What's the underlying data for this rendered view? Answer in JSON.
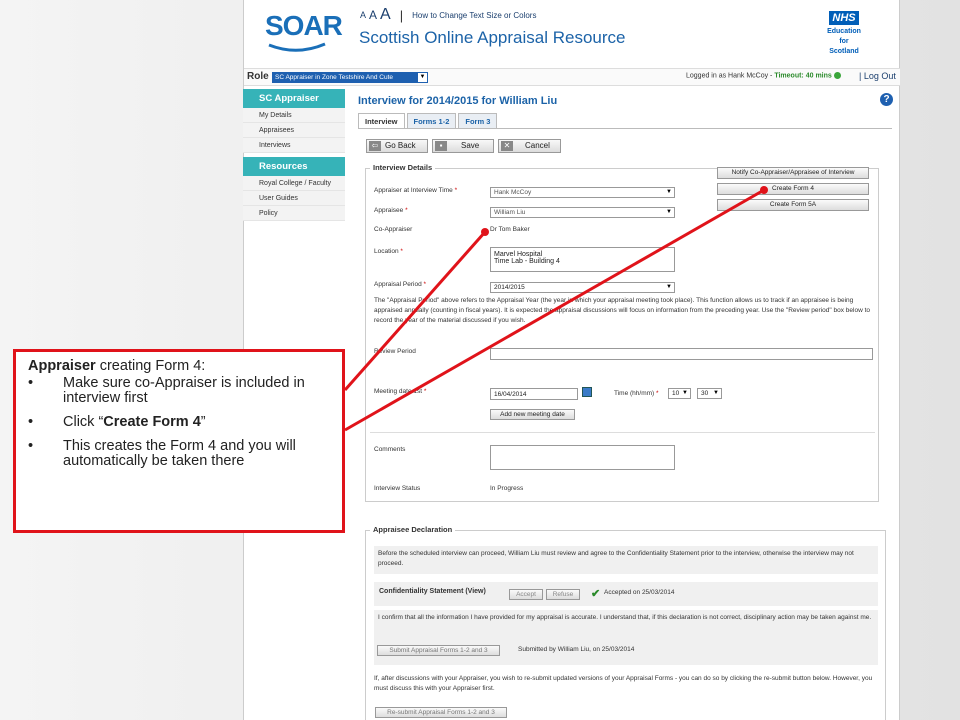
{
  "header": {
    "logo_text": "SOAR",
    "text_size_a_small": "A",
    "text_size_a_medium": "A",
    "text_size_a_large": "A",
    "text_size_separator": "|",
    "text_size_link": "How to Change Text Size or Colors",
    "site_title": "Scottish Online Appraisal Resource",
    "nhs_logo": "NHS",
    "nhs_sub_1": "Education",
    "nhs_sub_2": "for",
    "nhs_sub_3": "Scotland"
  },
  "rolebar": {
    "role_label": "Role",
    "role_value": "SC Appraiser in Zone Testshire And Cute",
    "logged_in_prefix": "Logged in as Hank McCoy - ",
    "timeout_label": "Timeout:",
    "timeout_value": "40 mins",
    "logout": "Log Out"
  },
  "sidebar": {
    "section1": "SC Appraiser",
    "items1": [
      "My Details",
      "Appraisees",
      "Interviews"
    ],
    "section2": "Resources",
    "items2": [
      "Royal College / Faculty",
      "User Guides",
      "Policy"
    ]
  },
  "main": {
    "title": "Interview for 2014/2015 for William Liu",
    "help": "?",
    "tabs": [
      "Interview",
      "Forms 1-2",
      "Form 3"
    ],
    "buttons": {
      "go_back": "Go Back",
      "save": "Save",
      "cancel": "Cancel"
    }
  },
  "details": {
    "legend": "Interview Details",
    "notify_button": "Notify Co-Appraiser/Appraisee of Interview",
    "create_form4": "Create Form 4",
    "create_form5a": "Create Form 5A",
    "appraiser_label": "Appraiser at Interview Time",
    "appraiser_value": "Hank McCoy",
    "appraisee_label": "Appraisee",
    "appraisee_value": "William Liu",
    "coappraiser_label": "Co-Appraiser",
    "coappraiser_value": "Dr Tom Baker",
    "location_label": "Location",
    "location_line1": "Marvel Hospital",
    "location_line2": "Time Lab - Building 4",
    "period_label": "Appraisal Period",
    "period_value": "2014/2015",
    "period_note": "The \"Appraisal Period\" above refers to the Appraisal Year (the year in which your appraisal meeting took place). This function allows us to track if an appraisee is being appraised annually (counting in fiscal years). It is expected the appraisal discussions will focus on information from the preceding year. Use the \"Review period\" box below to record the year of the material discussed if you wish.",
    "review_label": "Review Period",
    "meeting_label": "Meeting date 1st",
    "meeting_value": "16/04/2014",
    "time_label": "Time (hh/mm)",
    "time_hh": "10",
    "time_mm": "30",
    "add_meeting": "Add new meeting date",
    "comments_label": "Comments",
    "status_label": "Interview Status",
    "status_value": "In Progress",
    "required_mark": "*"
  },
  "declaration": {
    "legend": "Appraisee Declaration",
    "intro": "Before the scheduled interview can proceed, William Liu must review and agree to the Confidentiality Statement prior to the interview, otherwise the interview may not proceed.",
    "conf_label": "Confidentiality Statement (View)",
    "accept": "Accept",
    "refuse": "Refuse",
    "accepted_text": "Accepted on 25/03/2014",
    "confirm_text": "I confirm that all the information I have provided for my appraisal is accurate. I understand that, if this declaration is not correct, disciplinary action may be taken against me.",
    "submit_button": "Submit Appraisal Forms 1-2 and 3",
    "submitted_text": "Submitted by William Liu, on 25/03/2014",
    "resubmit_text": "If, after discussions with your Appraiser, you wish to re-submit updated versions of your Appraisal Forms - you can do so by clicking the re-submit button below. However, you must discuss this with your Appraiser first.",
    "resubmit_button": "Re-submit Appraisal Forms 1-2 and 3"
  },
  "callout": {
    "head_bold": "Appraiser",
    "head_rest": " creating Form 4:",
    "bullet1": "Make sure co-Appraiser is included in interview first",
    "bullet2_pre": "Click “",
    "bullet2_bold": "Create Form 4",
    "bullet2_post": "”",
    "bullet3": "This creates the Form 4 and you will automatically be taken there",
    "border_color": "#e0131a"
  }
}
